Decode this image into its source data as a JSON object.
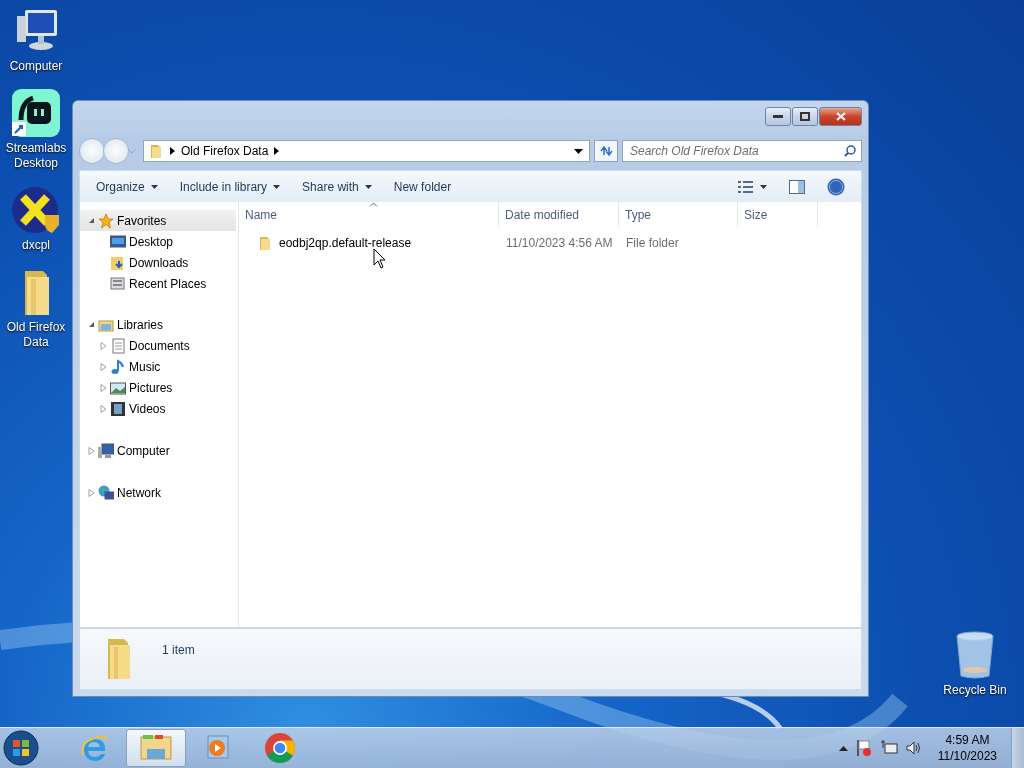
{
  "desktop_icons": [
    {
      "label": "Computer",
      "kind": "computer"
    },
    {
      "label": "Streamlabs Desktop",
      "kind": "streamlabs",
      "shortcut": true
    },
    {
      "label": "dxcpl",
      "kind": "dxcpl"
    },
    {
      "label": "Old Firefox Data",
      "kind": "folder"
    }
  ],
  "recycle_bin": {
    "label": "Recycle Bin"
  },
  "window": {
    "address": {
      "path": [
        "Old Firefox Data"
      ]
    },
    "search": {
      "placeholder": "Search Old Firefox Data"
    },
    "toolbar": [
      {
        "label": "Organize",
        "dropdown": true
      },
      {
        "label": "Include in library",
        "dropdown": true
      },
      {
        "label": "Share with",
        "dropdown": true
      },
      {
        "label": "New folder",
        "dropdown": false
      }
    ],
    "nav": [
      {
        "label": "Favorites",
        "kind": "favorites",
        "expanded": true,
        "selected": true,
        "children": [
          {
            "label": "Desktop",
            "kind": "desktop"
          },
          {
            "label": "Downloads",
            "kind": "downloads"
          },
          {
            "label": "Recent Places",
            "kind": "recent"
          }
        ]
      },
      {
        "label": "Libraries",
        "kind": "libraries",
        "expanded": true,
        "selected": false,
        "children": [
          {
            "label": "Documents",
            "kind": "documents",
            "expanded": false
          },
          {
            "label": "Music",
            "kind": "music",
            "expanded": false
          },
          {
            "label": "Pictures",
            "kind": "pictures",
            "expanded": false
          },
          {
            "label": "Videos",
            "kind": "videos",
            "expanded": false
          }
        ]
      },
      {
        "label": "Computer",
        "kind": "computer",
        "expanded": false,
        "selected": false
      },
      {
        "label": "Network",
        "kind": "network",
        "expanded": false,
        "selected": false
      }
    ],
    "columns": [
      {
        "label": "Name",
        "sorted": true
      },
      {
        "label": "Date modified",
        "sorted": false
      },
      {
        "label": "Type",
        "sorted": false
      },
      {
        "label": "Size",
        "sorted": false
      }
    ],
    "rows": [
      {
        "name": "eodbj2qp.default-release",
        "date_modified": "11/10/2023 4:56 AM",
        "type": "File folder",
        "size": ""
      }
    ],
    "status": "1 item"
  },
  "taskbar": {
    "items": [
      {
        "kind": "ie",
        "selected": false
      },
      {
        "kind": "explorer",
        "selected": true
      },
      {
        "kind": "media",
        "selected": false
      },
      {
        "kind": "chrome",
        "selected": false
      }
    ],
    "time": "4:59 AM",
    "date": "11/10/2023"
  }
}
